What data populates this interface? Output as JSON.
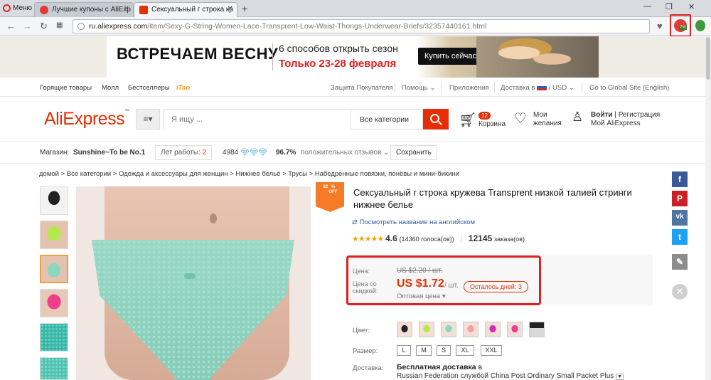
{
  "browser": {
    "menu_label": "Меню",
    "tabs": [
      {
        "title": "Лучшие купоны с AliExp"
      },
      {
        "title": "Сексуальный г строка кр"
      }
    ],
    "new_tab": "+",
    "url_domain": "ru.aliexpress.com",
    "url_path": "/item/Sexy-G-String-Women-Lace-Transprent-Low-Waist-Thongs-Underwear-Briefs/32357440161.html",
    "ext_badge": "7%"
  },
  "banner": {
    "headline": "ВСТРЕЧАЕМ ВЕСНУ",
    "subline": "6 способов открыть сезон",
    "dates": "Только 23-28 февраля",
    "button": "Купить сейчас"
  },
  "topnav": {
    "left": [
      "Горящие товары",
      "Молл",
      "Бестселлеры",
      "iTao"
    ],
    "right": [
      "Защита Покупателя",
      "Помощь",
      "Приложения",
      "Доставка в",
      "/ USD",
      "Go to Global Site (English)"
    ]
  },
  "header": {
    "logo": "AliExpress",
    "search_placeholder": "Я ищу ...",
    "category": "Все категории",
    "cart_count": "12",
    "cart_label": "Корзина",
    "wish_line1": "Мои",
    "wish_line2": "желания",
    "login": "Войти",
    "register": "Регистрация",
    "my_ali": "Мой AliExpress"
  },
  "store": {
    "label": "Магазин:",
    "name": "Sunshine~To be No.1",
    "years_label": "Лет работы:",
    "years": "2",
    "score": "4984",
    "feedback_pct": "96.7%",
    "feedback_label": "положительных отзывов",
    "save": "Сохранить"
  },
  "breadcrumb": "домой > Все категории > Одежда и аксессуары для женщин > Нижнее бельё > Трусы > Набедренные повязки, понёвы и мини-бикини",
  "product": {
    "discount": "22",
    "discount_pct": "%",
    "discount_off": "OFF",
    "title": "Сексуальный г строка кружева Transprent низкой талией стринги нижнее белье",
    "translate_link": "Посмотреть название на английском",
    "rating": "4.6",
    "votes": "(14360 голоса(ов))",
    "orders": "12145",
    "orders_label": "заказа(ов)",
    "price_label": "Цена:",
    "old_price": "US $2.20 / шт.",
    "discount_label_1": "Цена со",
    "discount_label_2": "скидкой:",
    "new_price": "US $1.72",
    "unit": "/ шт.",
    "days_left": "Осталось дней: 3",
    "wholesale": "Оптовая цена",
    "color_label": "Цвет:",
    "size_label": "Размер:",
    "sizes": [
      "L",
      "M",
      "S",
      "XL",
      "XXL"
    ],
    "delivery_label": "Доставка:",
    "delivery_title": "Бесплатная доставка",
    "delivery_in": "в",
    "delivery_detail": "Russian Federation службой China Post Ordinary Small Packet Plus"
  },
  "colors": {
    "accent": "#e62e04",
    "badge_orange": "#f57b26",
    "highlight_frame": "#e02020"
  }
}
